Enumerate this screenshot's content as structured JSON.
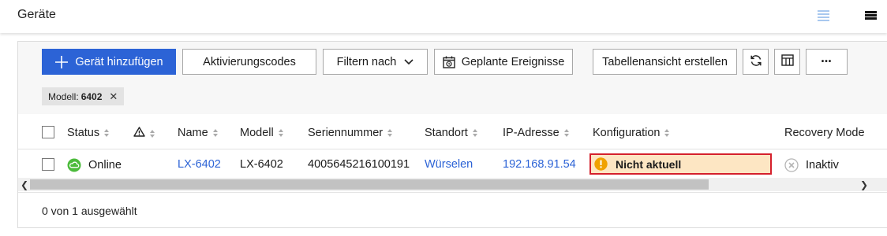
{
  "header": {
    "title": "Geräte"
  },
  "toolbar": {
    "add_device": "Gerät hinzufügen",
    "activation_codes": "Aktivierungscodes",
    "filter_by": "Filtern nach",
    "scheduled_events": "Geplante Ereignisse",
    "create_table_view": "Tabellenansicht erstellen",
    "more": "•••"
  },
  "filter_chip": {
    "label": "Modell:",
    "value": "6402"
  },
  "table": {
    "columns": [
      "Status",
      "",
      "Name",
      "Modell",
      "Seriennummer",
      "Standort",
      "IP-Adresse",
      "Konfiguration",
      "Recovery Mode"
    ],
    "rows": [
      {
        "status": "Online",
        "name": "LX-6402",
        "model": "LX-6402",
        "serial": "4005645216100191",
        "location": "Würselen",
        "ip": "192.168.91.54",
        "configuration": "Nicht aktuell",
        "recovery_mode": "Inaktiv"
      }
    ]
  },
  "footer": {
    "selection": "0 von 1 ausgewählt"
  },
  "colors": {
    "accent": "#2c63d6",
    "online": "#4cbb3c",
    "warning": "#f0a100",
    "warning_bg": "#fde6c3",
    "alert_border": "#d5202c"
  },
  "icons": [
    "list-view-icon",
    "compact-view-icon",
    "plus-icon",
    "chevron-down-icon",
    "calendar-clock-icon",
    "refresh-icon",
    "table-layout-icon",
    "close-icon",
    "warning-triangle-icon",
    "cloud-online-icon",
    "exclamation-icon",
    "inactive-x-icon",
    "scroll-left-icon",
    "scroll-right-icon"
  ]
}
